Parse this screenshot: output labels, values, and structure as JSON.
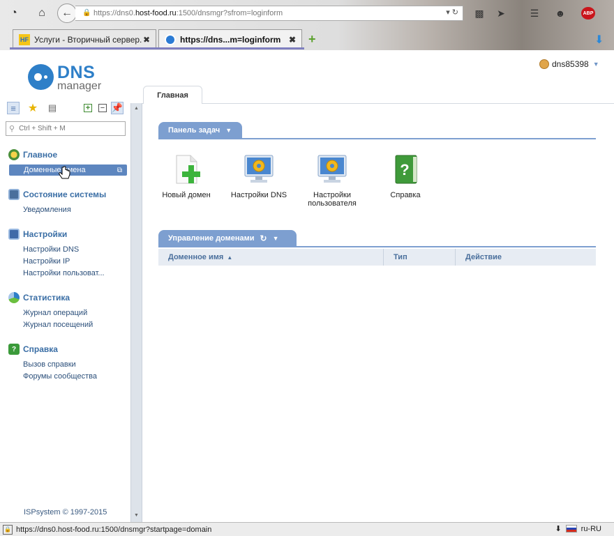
{
  "browser": {
    "url_prefix": "https://dns0.",
    "url_host": "host-food.ru",
    "url_suffix": ":1500/dnsmgr?sfrom=loginform",
    "tabs": [
      {
        "favicon": "HF",
        "title": "Услуги - Вторичный сервер...",
        "active": false
      },
      {
        "favicon": "dns-logo",
        "title": "https://dns...m=loginform",
        "active": true
      }
    ],
    "adblock_label": "ABP",
    "status_url": "https://dns0.host-food.ru:1500/dnsmgr?startpage=domain",
    "locale": "ru-RU"
  },
  "app": {
    "logo_primary": "DNS",
    "logo_secondary": "manager",
    "username": "dns85398",
    "main_tab": "Главная"
  },
  "sidebar": {
    "search_placeholder": "Ctrl + Shift + M",
    "groups": [
      {
        "title": "Главное",
        "icon": "home-icon",
        "items": [
          {
            "label": "Доменные имена",
            "active": true
          }
        ]
      },
      {
        "title": "Состояние системы",
        "icon": "monitor-icon",
        "items": [
          {
            "label": "Уведомления"
          }
        ]
      },
      {
        "title": "Настройки",
        "icon": "settings-icon",
        "items": [
          {
            "label": "Настройки DNS"
          },
          {
            "label": "Настройки IP"
          },
          {
            "label": "Настройки пользоват..."
          }
        ]
      },
      {
        "title": "Статистика",
        "icon": "stats-icon",
        "items": [
          {
            "label": "Журнал операций"
          },
          {
            "label": "Журнал посещений"
          }
        ]
      },
      {
        "title": "Справка",
        "icon": "help-icon",
        "items": [
          {
            "label": "Вызов справки"
          },
          {
            "label": "Форумы сообщества"
          }
        ]
      }
    ],
    "copyright": "ISPsystem © 1997-2015"
  },
  "dashboard": {
    "tasks_title": "Панель задач",
    "tasks": [
      {
        "label": "Новый домен",
        "icon": "new-domain-icon"
      },
      {
        "label": "Настройки DNS",
        "icon": "dns-settings-icon"
      },
      {
        "label": "Настройки пользователя",
        "icon": "user-settings-icon"
      },
      {
        "label": "Справка",
        "icon": "help-book-icon"
      }
    ],
    "domains_title": "Управление доменами",
    "columns": [
      "Доменное имя",
      "Тип",
      "Действие"
    ],
    "sort_column": "Доменное имя",
    "sort_direction": "ascending"
  },
  "colors": {
    "accent": "#7d9fd0",
    "brand": "#2e7fc8",
    "link": "#3a6ea5"
  }
}
